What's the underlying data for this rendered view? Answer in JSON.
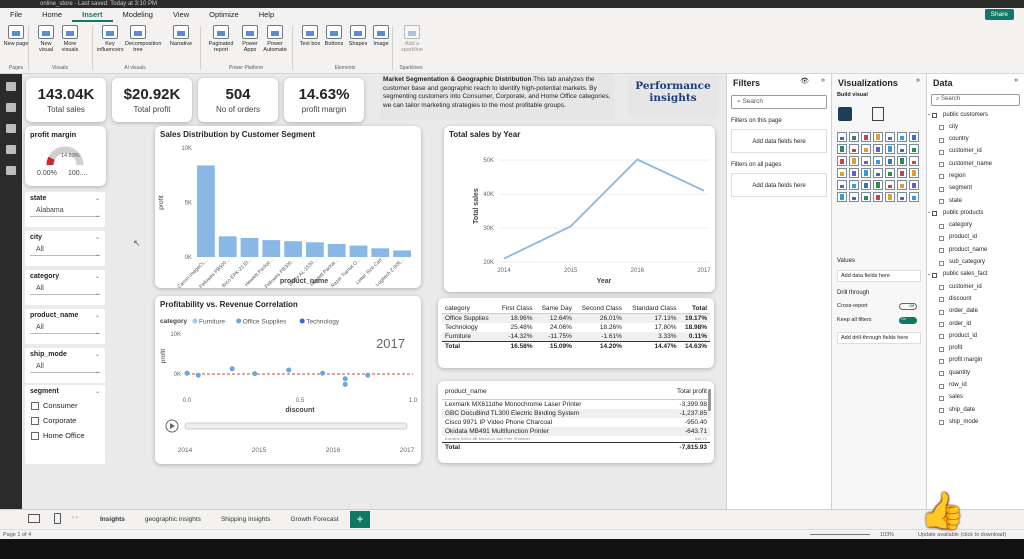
{
  "titlebar": {
    "title": "online_store · Last saved: Today at 3:10 PM"
  },
  "menu": {
    "items": [
      "File",
      "Home",
      "Insert",
      "Modeling",
      "View",
      "Optimize",
      "Help"
    ],
    "active": "Insert",
    "share_label": "Share"
  },
  "ribbon": {
    "buttons": [
      "New page",
      "New visual",
      "More visuals",
      "Key influencers",
      "Decomposition tree",
      "Narrative",
      "Paginated report",
      "Power Apps",
      "Power Automate",
      "Text box",
      "Buttons",
      "Shapes",
      "Image",
      "Add a sparkline"
    ],
    "groups": [
      "Pages",
      "Visuals",
      "AI visuals",
      "Power Platform",
      "Elements",
      "Sparklines"
    ]
  },
  "kpis": [
    {
      "value": "143.04K",
      "label": "Total sales"
    },
    {
      "value": "$20.92K",
      "label": "Total profit"
    },
    {
      "value": "504",
      "label": "No of orders"
    },
    {
      "value": "14.63%",
      "label": "profit margin"
    }
  ],
  "description": {
    "title": "Market Segmentation & Geographic Distribution",
    "body": " This tab analyzes the customer base and geographic reach to identify high-potential markets. By segmenting customers into Consumer, Corporate, and Home Office categories, we can tailor marketing strategies to the most profitable groups."
  },
  "performance": "Performance insights",
  "gauge": {
    "title": "profit margin",
    "value_label": "14.63%",
    "min": "0.00%",
    "max": "100....",
    "value": 0.1463
  },
  "slicers": [
    {
      "title": "state",
      "value": "Alabama"
    },
    {
      "title": "city",
      "value": "All"
    },
    {
      "title": "category",
      "value": "All"
    },
    {
      "title": "product_name",
      "value": "All"
    },
    {
      "title": "ship_mode",
      "value": "All"
    }
  ],
  "segment": {
    "title": "segment",
    "options": [
      "Consumer",
      "Corporate",
      "Home Office"
    ]
  },
  "chart_data": [
    {
      "type": "bar",
      "title": "Sales Distribution by Customer Segment",
      "xlabel": "product_name",
      "ylabel": "profit",
      "categories": [
        "Canon imageCL...",
        "Fellowes PB500...",
        "Ibico EPK-21 El...",
        "Hewlett Packar...",
        "Fellowes PB300...",
        "Sharp AL-1530...",
        "Hewlett Packar...",
        "Razer Tiamat O...",
        "Letter Size Cart",
        "Logitech Z-906..."
      ],
      "values": [
        8400,
        1900,
        1750,
        1550,
        1450,
        1350,
        1200,
        1050,
        800,
        600
      ],
      "yticks": [
        "0K",
        "5K",
        "10K"
      ],
      "ylim": [
        0,
        10000
      ],
      "color": "#8ab8e6"
    },
    {
      "type": "line",
      "title": "Total sales by Year",
      "xlabel": "Year",
      "ylabel": "Total sales",
      "x": [
        2014,
        2015,
        2016,
        2017
      ],
      "values": [
        21000,
        30500,
        50200,
        41000
      ],
      "yticks": [
        "20K",
        "30K",
        "40K",
        "50K"
      ],
      "ylim": [
        20000,
        53000
      ],
      "color": "#8ab8e6"
    },
    {
      "type": "scatter",
      "title": "Profitability vs. Revenue Correlation",
      "xlabel": "discount",
      "ylabel": "profit",
      "legend_title": "category",
      "legend": [
        {
          "name": "Furniture",
          "color": "#a6c8ec"
        },
        {
          "name": "Office Supplies",
          "color": "#6aa6e0"
        },
        {
          "name": "Technology",
          "color": "#2f6fd0"
        }
      ],
      "play_label": "2017",
      "xticks": [
        "0.0",
        "0.5",
        "1.0"
      ],
      "yticks": [
        "0K",
        "10K"
      ],
      "timeline_ticks": [
        "2014",
        "2015",
        "2016",
        "2017"
      ],
      "points": [
        {
          "x": 0.0,
          "y": 200
        },
        {
          "x": 0.05,
          "y": -300
        },
        {
          "x": 0.2,
          "y": 1300
        },
        {
          "x": 0.3,
          "y": 100
        },
        {
          "x": 0.45,
          "y": 1000
        },
        {
          "x": 0.6,
          "y": 200
        },
        {
          "x": 0.7,
          "y": -1200
        },
        {
          "x": 0.7,
          "y": -2600
        },
        {
          "x": 0.8,
          "y": -300
        }
      ]
    }
  ],
  "matrix": {
    "headers": [
      "category",
      "First Class",
      "Same Day",
      "Second Class",
      "Standard Class",
      "Total"
    ],
    "rows": [
      [
        "Office Supplies",
        "18.96%",
        "12.64%",
        "26.01%",
        "17.13%",
        "19.17%"
      ],
      [
        "Technology",
        "25.48%",
        "24.06%",
        "18.26%",
        "17.80%",
        "18.98%"
      ],
      [
        "Furniture",
        "-14.32%",
        "-11.75%",
        "-1.61%",
        "3.33%",
        "0.11%"
      ],
      [
        "Total",
        "16.58%",
        "15.09%",
        "14.20%",
        "14.47%",
        "14.63%"
      ]
    ]
  },
  "products": {
    "headers": [
      "product_name",
      "Total profit"
    ],
    "rows": [
      [
        "Lexmark MX611dhe Monochrome Laser Printer",
        "-3,399.98"
      ],
      [
        "GBC DocuBind TL300 Electric Binding System",
        "-1,237.85"
      ],
      [
        "Cisco 9971 IP Video Phone Charcoal",
        "-950.40"
      ],
      [
        "Okidata MB491 Multifunction Printer",
        "-643.71"
      ],
      [
        "Euroline SM12-8B MicroCut Jam Free Shredder",
        "-542.71"
      ]
    ],
    "total": [
      "Total",
      "-7,815.93"
    ]
  },
  "filters": {
    "title": "Filters",
    "search": "Search",
    "on_page": "Filters on this page",
    "on_all": "Filters on all pages",
    "add": "Add data fields here"
  },
  "viz": {
    "title": "Visualizations",
    "build": "Build visual",
    "values": "Values",
    "add": "Add data fields here",
    "drill": "Drill through",
    "cross": "Cross-report",
    "keep": "Keep all filters",
    "off": "Off",
    "on": "On",
    "add_drill": "Add drill-through fields here"
  },
  "data": {
    "title": "Data",
    "search": "Search",
    "fields": [
      {
        "t": "public customers",
        "tbl": true
      },
      {
        "t": "city"
      },
      {
        "t": "country"
      },
      {
        "t": "customer_id"
      },
      {
        "t": "customer_name"
      },
      {
        "t": "region"
      },
      {
        "t": "segment"
      },
      {
        "t": "state"
      },
      {
        "t": "public products",
        "tbl": true
      },
      {
        "t": "category"
      },
      {
        "t": "product_id"
      },
      {
        "t": "product_name"
      },
      {
        "t": "sub_category"
      },
      {
        "t": "public sales_fact",
        "tbl": true
      },
      {
        "t": "customer_id"
      },
      {
        "t": "discount"
      },
      {
        "t": "order_date"
      },
      {
        "t": "order_id"
      },
      {
        "t": "product_id"
      },
      {
        "t": "profit"
      },
      {
        "t": "profit margin"
      },
      {
        "t": "quantity"
      },
      {
        "t": "row_id"
      },
      {
        "t": "sales"
      },
      {
        "t": "ship_date"
      },
      {
        "t": "ship_mode"
      }
    ]
  },
  "tabs": [
    "Insights",
    "geographic insights",
    "Shipping Insights",
    "Growth Forecast"
  ],
  "active_tab": "Insights",
  "status": {
    "page": "Page 1 of 4",
    "zoom": "103%",
    "update": "Update available (click to download)"
  }
}
